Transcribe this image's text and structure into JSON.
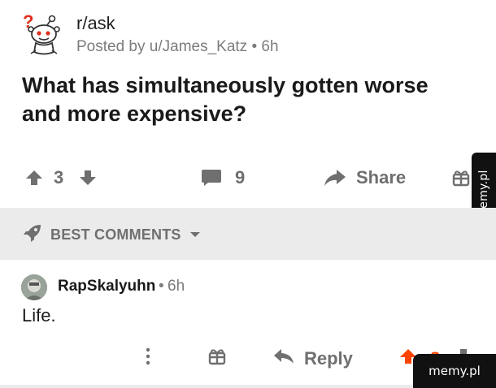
{
  "post": {
    "subreddit": "r/ask",
    "meta": "Posted by u/James_Katz • 6h",
    "title": "What has simultaneously gotten worse and more expensive?",
    "votes": "3",
    "comments": "9",
    "share_label": "Share"
  },
  "sort": {
    "label": "BEST COMMENTS"
  },
  "comment": {
    "username": "RapSkalyuhn",
    "separator": "•",
    "time": "6h",
    "body": "Life.",
    "reply_label": "Reply",
    "votes": "8"
  },
  "watermarks": {
    "side": "memy.pl",
    "corner": "memy.pl"
  },
  "colors": {
    "upvote_active": "#ff4500",
    "icon_gray": "#6f6f6f",
    "sort_bar_bg": "#ebebeb"
  },
  "icons": {
    "subreddit": "snoo-question-icon",
    "upvote": "arrow-up-icon",
    "downvote": "arrow-down-icon",
    "comments": "comment-bubble-icon",
    "share": "share-arrow-icon",
    "award": "gift-icon",
    "sort": "rocket-icon",
    "more": "more-vertical-icon",
    "reply": "reply-arrow-icon"
  }
}
